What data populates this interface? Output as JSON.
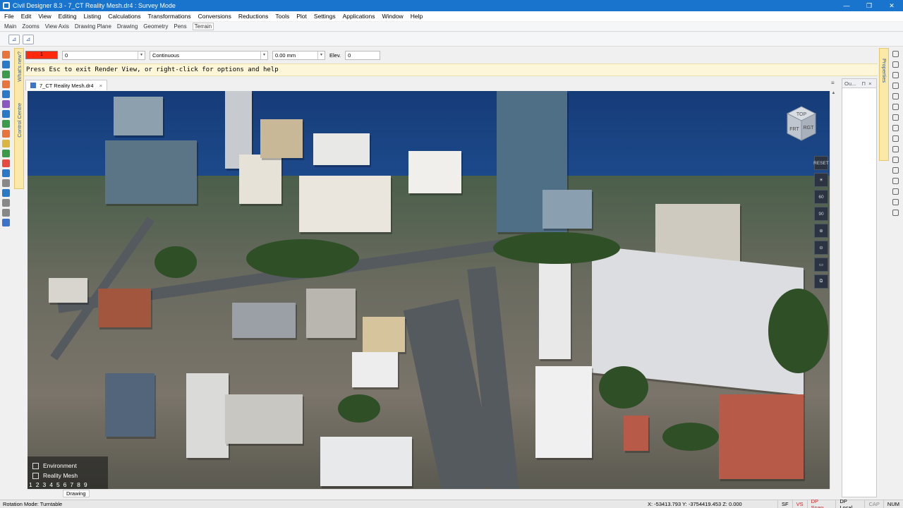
{
  "window": {
    "title": "Civil Designer 8.3 - 7_CT Reality Mesh.dr4 : Survey Mode",
    "minimize": "—",
    "maximize": "❐",
    "close": "✕"
  },
  "menu": [
    "File",
    "Edit",
    "View",
    "Editing",
    "Listing",
    "Calculations",
    "Transformations",
    "Conversions",
    "Reductions",
    "Tools",
    "Plot",
    "Settings",
    "Applications",
    "Window",
    "Help"
  ],
  "ribbon_tabs": [
    "Main",
    "Zooms",
    "View Axis",
    "Drawing Plane",
    "Drawing",
    "Geometry",
    "Pens",
    "Terrain"
  ],
  "active_ribbon_tab": "Terrain",
  "left_panel_label": "What's new?",
  "control_centre_label": "Control Centre",
  "properties_bar": {
    "color_value": "1",
    "layer_value": "0",
    "linetype_value": "Continuous",
    "width_value": "0.00 mm",
    "elev_label": "Elev.",
    "elev_value": "0"
  },
  "command_prompt": "Press Esc to exit Render View, or right-click for options and help",
  "document_tab": {
    "label": "7_CT Reality Mesh.dr4",
    "close": "×",
    "menu": "≡"
  },
  "navcube": {
    "top": "TOP",
    "front": "FRT",
    "right": "RGT"
  },
  "view_tools": [
    "RESET",
    "☀",
    "60",
    "90",
    "⊕",
    "⊖",
    "▭",
    "⧉"
  ],
  "layers": [
    {
      "label": "Environment",
      "checked": false
    },
    {
      "label": "Reality Mesh",
      "checked": false
    }
  ],
  "view_numbers": [
    "1",
    "2",
    "3",
    "4",
    "5",
    "6",
    "7",
    "8",
    "9"
  ],
  "sheet_tab": "Drawing",
  "right_panel": {
    "title": "Ou...",
    "pin": "⊓",
    "close": "×",
    "side_label": "Properties"
  },
  "status": {
    "mode": "Rotation Mode: Turntable",
    "coords": "X: -53413.793 Y: -3754419.453 Z: 0.000",
    "cells": [
      {
        "label": "SF",
        "style": "normal"
      },
      {
        "label": "VS",
        "style": "red"
      },
      {
        "label": "DP Snap",
        "style": "red"
      },
      {
        "label": "DP Local",
        "style": "normal"
      },
      {
        "label": "CAP",
        "style": "dim"
      },
      {
        "label": "NUM",
        "style": "normal"
      }
    ]
  },
  "colors": {
    "titlebar": "#1874cd",
    "color_swatch": "#ff2a0e",
    "prompt_bg": "#fdf6d8"
  }
}
